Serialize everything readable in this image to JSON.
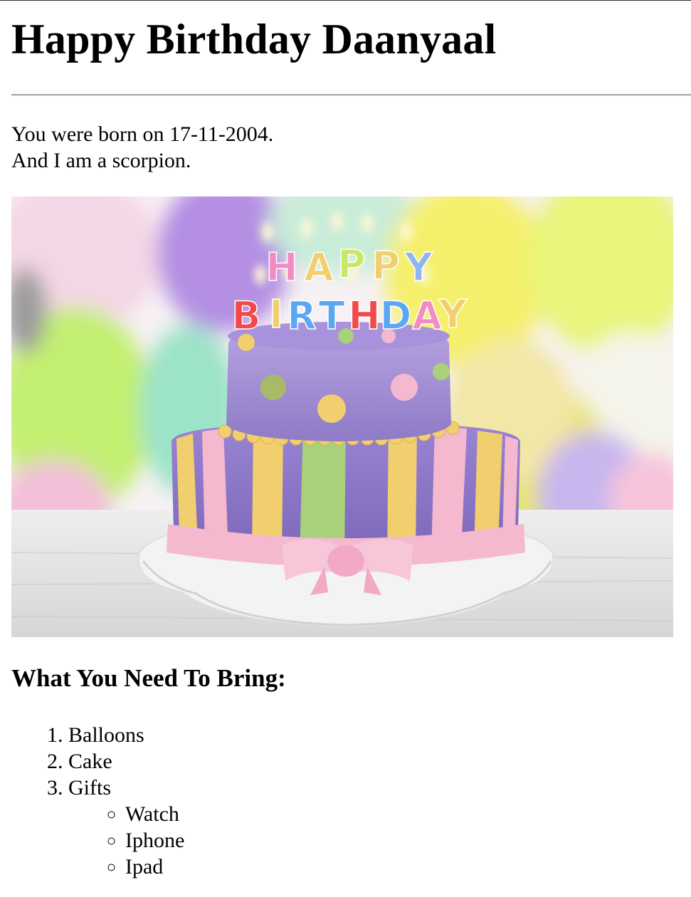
{
  "heading": "Happy Birthday Daanyaal",
  "intro": {
    "line1": "You were born on 17-11-2004.",
    "line2": "And I am a scorpion."
  },
  "image": {
    "alt": "Birthday cake",
    "candles_top": "HAPPY",
    "candles_bottom": "BIRTHDAY"
  },
  "section_heading": "What You Need To Bring:",
  "bring_list": [
    "Balloons",
    "Cake",
    "Gifts"
  ],
  "gifts_list": [
    "Watch",
    "Iphone",
    "Ipad"
  ],
  "colors": {
    "cake_purple": "#a58fd0",
    "ribbon_pink": "#f4b8cf",
    "stripe_yellow": "#f2cf6e",
    "stripe_green": "#a9d07a"
  }
}
